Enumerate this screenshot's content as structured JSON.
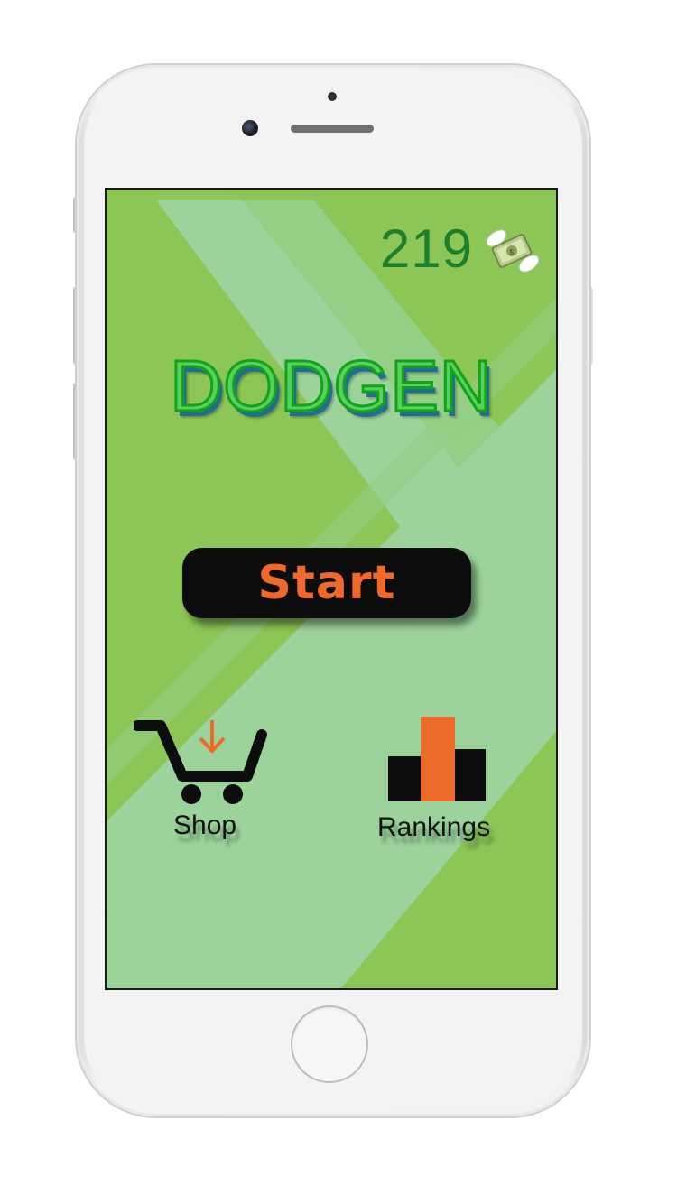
{
  "game": {
    "title": "DODGEN",
    "coins": "219",
    "start_label": "Start",
    "shop_label": "Shop",
    "rankings_label": "Rankings"
  },
  "icons": {
    "currency": "money-with-wings-icon",
    "shop": "shopping-cart-icon",
    "rankings": "podium-icon"
  },
  "colors": {
    "background": "#8cc656",
    "stripe": "#9bd39b",
    "title_fill": "#58d15a",
    "title_stroke": "#12a21c",
    "coins_text": "#1d7f2a",
    "start_text": "#f0692a",
    "start_button": "#0c0c0c",
    "accent_orange": "#ec6a2a"
  }
}
